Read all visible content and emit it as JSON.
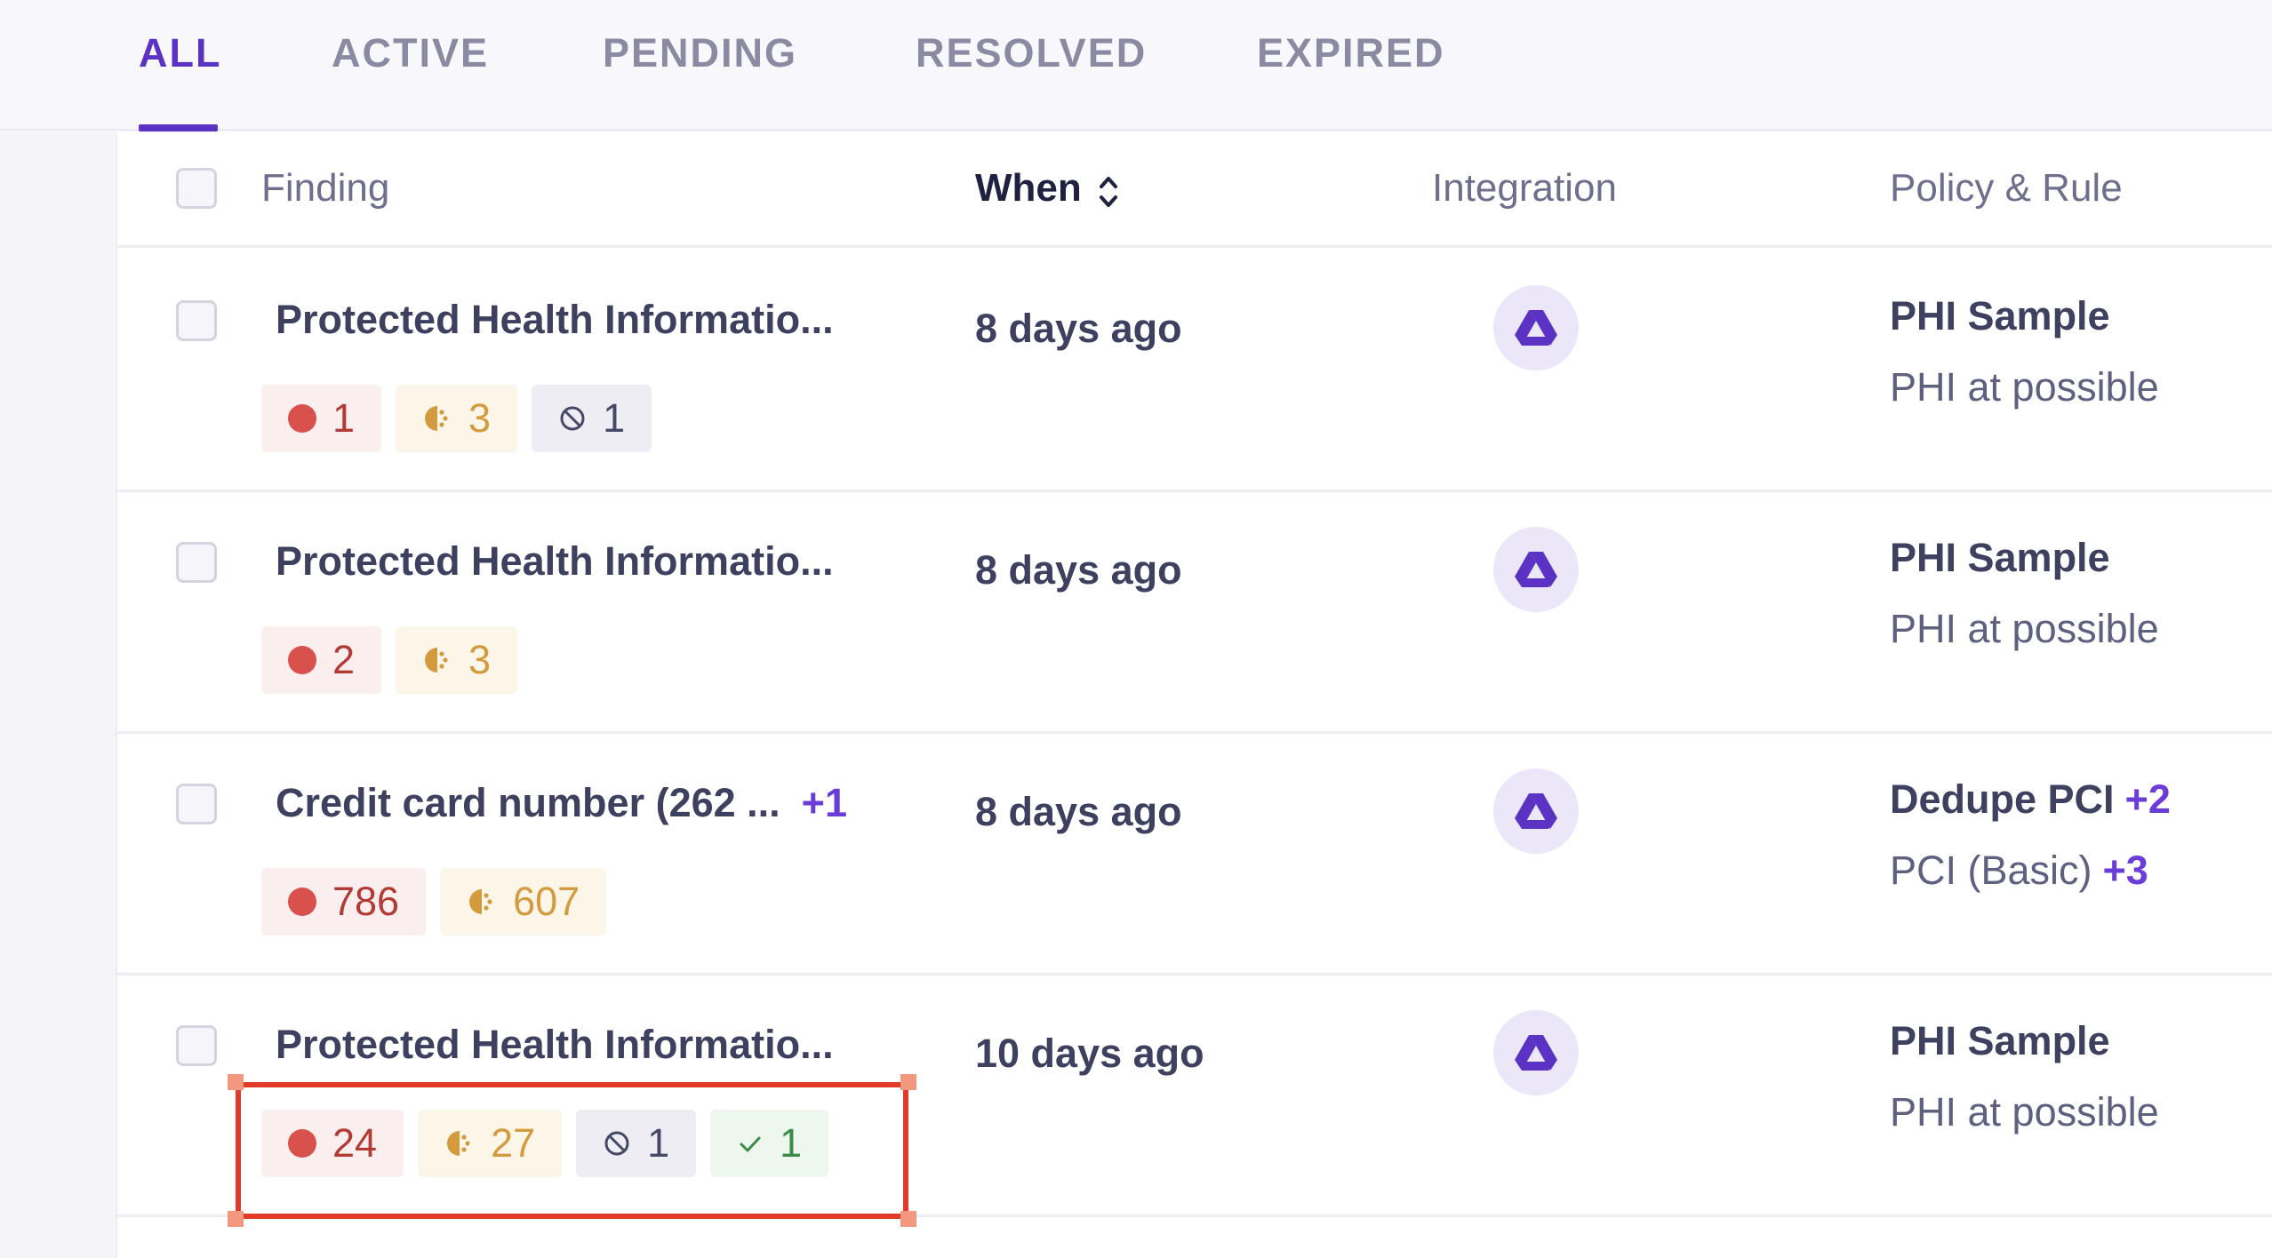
{
  "tabs": [
    {
      "label": "ALL",
      "active": true
    },
    {
      "label": "ACTIVE",
      "active": false
    },
    {
      "label": "PENDING",
      "active": false
    },
    {
      "label": "RESOLVED",
      "active": false
    },
    {
      "label": "EXPIRED",
      "active": false
    }
  ],
  "table": {
    "headers": {
      "finding": "Finding",
      "when": "When",
      "integration": "Integration",
      "policy_rule": "Policy & Rule"
    },
    "rows": [
      {
        "finding": "Protected Health Informatio...",
        "finding_extra": "",
        "badges": {
          "red": "1",
          "orange": "3",
          "grey": "1",
          "green": ""
        },
        "when": "8 days ago",
        "integration_icon": "google-drive-icon",
        "policy": "PHI Sample",
        "policy_extra": "",
        "rule": "PHI at possible",
        "rule_extra": ""
      },
      {
        "finding": "Protected Health Informatio...",
        "finding_extra": "",
        "badges": {
          "red": "2",
          "orange": "3",
          "grey": "",
          "green": ""
        },
        "when": "8 days ago",
        "integration_icon": "google-drive-icon",
        "policy": "PHI Sample",
        "policy_extra": "",
        "rule": "PHI at possible",
        "rule_extra": ""
      },
      {
        "finding": "Credit card number (262 ...",
        "finding_extra": "+1",
        "badges": {
          "red": "786",
          "orange": "607",
          "grey": "",
          "green": ""
        },
        "when": "8 days ago",
        "integration_icon": "google-drive-icon",
        "policy": "Dedupe PCI",
        "policy_extra": "+2",
        "rule": "PCI (Basic)",
        "rule_extra": "+3"
      },
      {
        "finding": "Protected Health Informatio...",
        "finding_extra": "",
        "badges": {
          "red": "24",
          "orange": "27",
          "grey": "1",
          "green": "1"
        },
        "when": "10 days ago",
        "integration_icon": "google-drive-icon",
        "policy": "PHI Sample",
        "policy_extra": "",
        "rule": "PHI at possible",
        "rule_extra": ""
      }
    ]
  },
  "colors": {
    "accent": "#5b33c4",
    "critical": "#d9514c",
    "warning": "#d49a3e",
    "success": "#3d8a48",
    "highlight": "#e23a28"
  }
}
